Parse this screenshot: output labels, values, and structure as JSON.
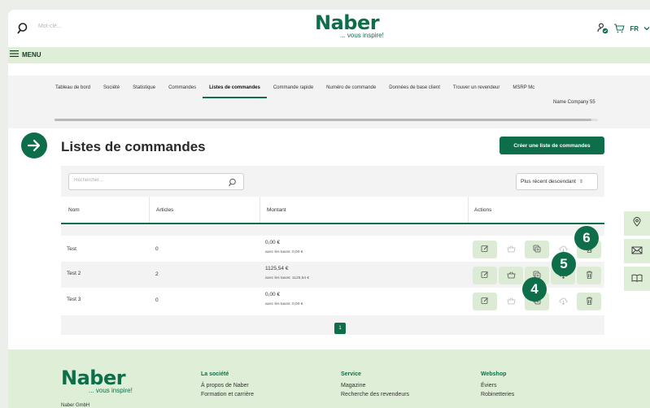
{
  "header": {
    "search_placeholder": "Mot-clé...",
    "logo_word": "Naber",
    "logo_tagline": "... vous inspire!",
    "language": "FR"
  },
  "menu": {
    "label": "MENU"
  },
  "subnav": {
    "items": [
      "Tableau de bord",
      "Société",
      "Statistique",
      "Commandes",
      "Listes de commandes",
      "Commande rapide",
      "Numéro de commande",
      "Données de base client",
      "Trouver un revendeur",
      "MSRP Mc"
    ],
    "active_index": 4,
    "company": "Name Company 55"
  },
  "main": {
    "title": "Listes de commandes",
    "create_button": "Créer une liste de commandes",
    "search_placeholder": "Rechercher...",
    "sort_value": "Plus récent descendant",
    "columns": {
      "name": "Nom",
      "articles": "Articles",
      "amount": "Montant",
      "actions": "Actions"
    },
    "rows": [
      {
        "name": "Test",
        "articles": "0",
        "amount": "0,00 €",
        "amount_tax": "avec les taxes: 0,00 €"
      },
      {
        "name": "Test 2",
        "articles": "2",
        "amount": "1125,54 €",
        "amount_tax": "avec les taxes: 1125,54 €"
      },
      {
        "name": "Test 3",
        "articles": "0",
        "amount": "0,00 €",
        "amount_tax": "avec les taxes: 0,00 €"
      }
    ],
    "page": "1"
  },
  "callouts": [
    "6",
    "5",
    "4"
  ],
  "footer": {
    "logo_word": "Naber",
    "logo_tagline": "... vous inspire!",
    "company": "Naber GmbH",
    "columns": [
      {
        "title": "La société",
        "items": [
          "À propos de Naber",
          "Formation et carrière"
        ]
      },
      {
        "title": "Service",
        "items": [
          "Magazine",
          "Recherche des revendeurs"
        ]
      },
      {
        "title": "Webshop",
        "items": [
          "Éviers",
          "Robinetteries"
        ]
      }
    ]
  },
  "colors": {
    "brand": "#0e6e4a",
    "light_green": "#dfeed6",
    "action_bg": "#dcebd4"
  }
}
